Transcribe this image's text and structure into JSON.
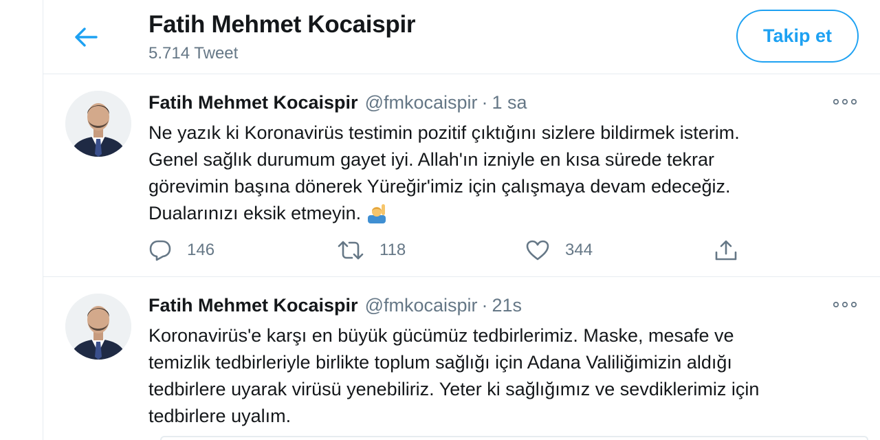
{
  "header": {
    "name": "Fatih Mehmet Kocaispir",
    "tweet_count": "5.714 Tweet",
    "follow_label": "Takip et"
  },
  "tweets": [
    {
      "name": "Fatih Mehmet Kocaispir",
      "handle": "@fmkocaispir",
      "separator": "·",
      "time": "1 sa",
      "lines": [
        "Ne yazık ki Koronavirüs testimin pozitif çıktığını sizlere bildirmek isterim.",
        "Genel sağlık durumum gayet iyi. Allah'ın izniyle en kısa sürede tekrar",
        "görevimin başına dönerek Yüreğir'imiz için çalışmaya devam edeceğiz.",
        "Dualarınızı eksik etmeyin."
      ],
      "emoji": "raising-hand-emoji",
      "replies": "146",
      "retweets": "118",
      "likes": "344"
    },
    {
      "name": "Fatih Mehmet Kocaispir",
      "handle": "@fmkocaispir",
      "separator": "·",
      "time": "21s",
      "lines": [
        "Koronavirüs'e karşı en büyük gücümüz tedbirlerimiz. Maske, mesafe ve",
        "temizlik tedbirleriyle birlikte toplum sağlığı için Adana Valiliğimizin aldığı",
        "tedbirlere uyarak virüsü yenebiliriz. Yeter ki sağlığımız ve sevdiklerimiz için",
        "tedbirlere uyalım."
      ]
    }
  ],
  "icons": {
    "back": "arrow-left-icon",
    "more": "more-dots-icon",
    "reply": "reply-icon",
    "retweet": "retweet-icon",
    "like": "heart-icon",
    "share": "share-icon"
  },
  "colors": {
    "accent": "#1da1f2",
    "text": "#14171a",
    "muted": "#657786",
    "border": "#e6ecf0"
  }
}
